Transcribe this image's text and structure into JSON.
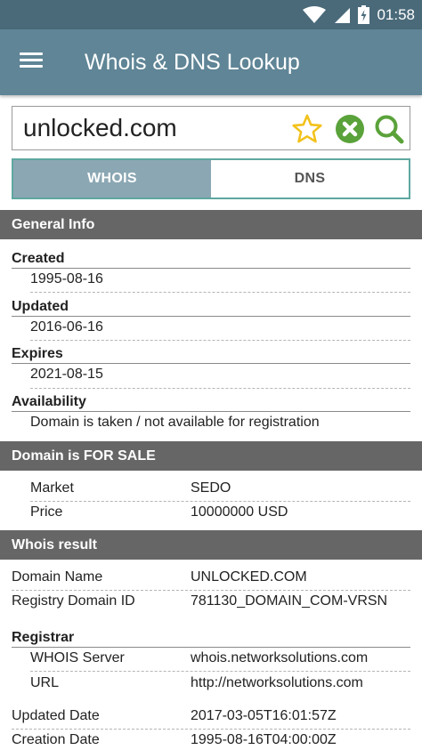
{
  "status_bar": {
    "time": "01:58"
  },
  "app_bar": {
    "title": "Whois & DNS Lookup"
  },
  "search": {
    "value": "unlocked.com"
  },
  "tabs": [
    {
      "label": "WHOIS",
      "active": true
    },
    {
      "label": "DNS",
      "active": false
    }
  ],
  "general_info": {
    "header": "General Info",
    "items": [
      {
        "label": "Created",
        "value": "1995-08-16"
      },
      {
        "label": "Updated",
        "value": "2016-06-16"
      },
      {
        "label": "Expires",
        "value": "2021-08-15"
      },
      {
        "label": "Availability",
        "value": "Domain is taken / not available for registration"
      }
    ]
  },
  "for_sale": {
    "header": "Domain is FOR SALE",
    "rows": [
      {
        "label": "Market",
        "value": "SEDO"
      },
      {
        "label": "Price",
        "value": "10000000 USD"
      }
    ]
  },
  "whois_result": {
    "header": "Whois result",
    "rows": [
      {
        "label": "Domain Name",
        "value": "UNLOCKED.COM"
      },
      {
        "label": "Registry Domain ID",
        "value": "781130_DOMAIN_COM-VRSN"
      }
    ],
    "registrar": {
      "label": "Registrar",
      "rows": [
        {
          "label": "WHOIS Server",
          "value": "whois.networksolutions.com"
        },
        {
          "label": "URL",
          "value": "http://networksolutions.com"
        }
      ]
    },
    "dates": [
      {
        "label": "Updated Date",
        "value": "2017-03-05T16:01:57Z"
      },
      {
        "label": "Creation Date",
        "value": "1995-08-16T04:00:00Z"
      }
    ]
  },
  "colors": {
    "app_bar": "#5f8596",
    "status_bar": "#4a6a7a",
    "section_header": "#666666",
    "tab_active": "#8ba7b3",
    "tab_border": "#5ea8a0",
    "star": "#f2c21b",
    "clear": "#5aa23a",
    "search": "#5aa23a"
  },
  "icons": [
    "wifi-icon",
    "signal-icon",
    "battery-icon",
    "menu-icon",
    "star-icon",
    "clear-icon",
    "search-icon"
  ]
}
